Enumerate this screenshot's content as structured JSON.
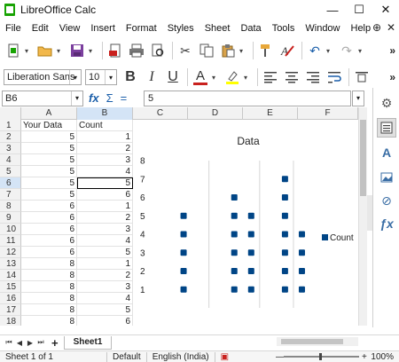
{
  "window": {
    "title": "LibreOffice Calc",
    "minimize_glyph": "—",
    "maximize_glyph": "☐",
    "close_glyph": "✕"
  },
  "menu": [
    "File",
    "Edit",
    "View",
    "Insert",
    "Format",
    "Styles",
    "Sheet",
    "Data",
    "Tools",
    "Window",
    "Help"
  ],
  "toolbar": {
    "font_name": "Liberation Sans",
    "font_size": "10",
    "bold_label": "B",
    "italic_label": "I",
    "underline_label": "U",
    "font_color_label": "A",
    "more_label": "»"
  },
  "formula_bar": {
    "cell_ref": "B6",
    "fx_label": "fx",
    "sum_label": "Σ",
    "equals_label": "=",
    "content": "5"
  },
  "columns": [
    "A",
    "B",
    "C",
    "D",
    "E",
    "F"
  ],
  "active_column": "B",
  "rows": [
    {
      "num": "1",
      "a": "Your Data",
      "b": "Count"
    },
    {
      "num": "2",
      "a": "5",
      "b": "1"
    },
    {
      "num": "3",
      "a": "5",
      "b": "2"
    },
    {
      "num": "4",
      "a": "5",
      "b": "3"
    },
    {
      "num": "5",
      "a": "5",
      "b": "4"
    },
    {
      "num": "6",
      "a": "5",
      "b": "5"
    },
    {
      "num": "7",
      "a": "5",
      "b": "6"
    },
    {
      "num": "8",
      "a": "6",
      "b": "1"
    },
    {
      "num": "9",
      "a": "6",
      "b": "2"
    },
    {
      "num": "10",
      "a": "6",
      "b": "3"
    },
    {
      "num": "11",
      "a": "6",
      "b": "4"
    },
    {
      "num": "12",
      "a": "6",
      "b": "5"
    },
    {
      "num": "13",
      "a": "8",
      "b": "1"
    },
    {
      "num": "14",
      "a": "8",
      "b": "2"
    },
    {
      "num": "15",
      "a": "8",
      "b": "3"
    },
    {
      "num": "16",
      "a": "8",
      "b": "4"
    },
    {
      "num": "17",
      "a": "8",
      "b": "5"
    },
    {
      "num": "18",
      "a": "8",
      "b": "6"
    }
  ],
  "active_row": "6",
  "chart_data": {
    "type": "scatter",
    "title": "Data",
    "legend": "right",
    "ylim": [
      0,
      8
    ],
    "yticks": [
      "1",
      "2",
      "3",
      "4",
      "5",
      "6",
      "7",
      "8"
    ],
    "marker_color": "#004586",
    "series": [
      {
        "name": "Count",
        "points": [
          {
            "x": 1,
            "y": 1
          },
          {
            "x": 1,
            "y": 2
          },
          {
            "x": 1,
            "y": 3
          },
          {
            "x": 1,
            "y": 4
          },
          {
            "x": 1,
            "y": 5
          },
          {
            "x": 4,
            "y": 1
          },
          {
            "x": 4,
            "y": 2
          },
          {
            "x": 4,
            "y": 3
          },
          {
            "x": 4,
            "y": 4
          },
          {
            "x": 4,
            "y": 5
          },
          {
            "x": 4,
            "y": 6
          },
          {
            "x": 5,
            "y": 1
          },
          {
            "x": 5,
            "y": 2
          },
          {
            "x": 5,
            "y": 3
          },
          {
            "x": 5,
            "y": 4
          },
          {
            "x": 5,
            "y": 5
          },
          {
            "x": 7,
            "y": 1
          },
          {
            "x": 7,
            "y": 2
          },
          {
            "x": 7,
            "y": 3
          },
          {
            "x": 7,
            "y": 4
          },
          {
            "x": 7,
            "y": 5
          },
          {
            "x": 7,
            "y": 6
          },
          {
            "x": 7,
            "y": 7
          },
          {
            "x": 8,
            "y": 1
          },
          {
            "x": 8,
            "y": 2
          },
          {
            "x": 8,
            "y": 3
          },
          {
            "x": 8,
            "y": 4
          }
        ]
      }
    ]
  },
  "sheet_tabs": {
    "active_tab": "Sheet1",
    "add_label": "+"
  },
  "status": {
    "sheet_info": "Sheet 1 of 1",
    "page_style": "Default",
    "language": "English (India)",
    "zoom_out": "—",
    "zoom_in": "+",
    "zoom": "100%"
  }
}
